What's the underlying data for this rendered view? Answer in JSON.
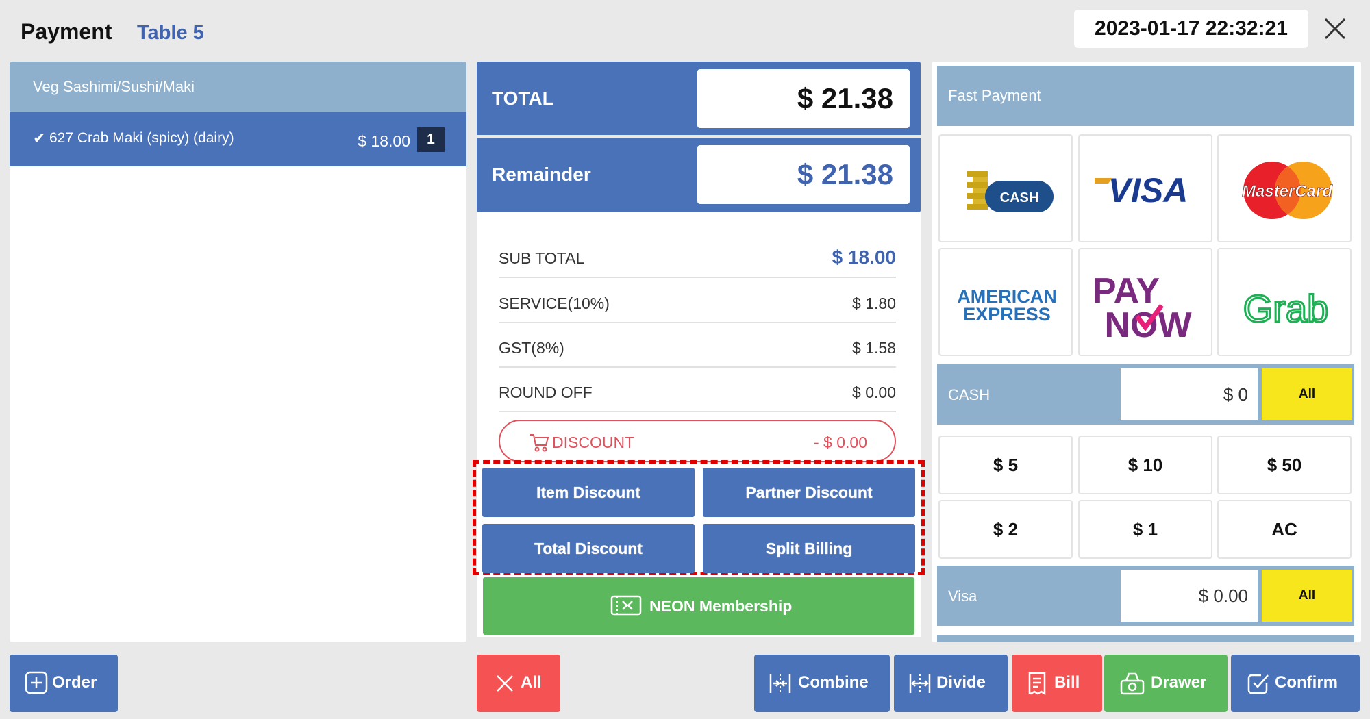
{
  "header": {
    "title": "Payment",
    "table": "Table 5",
    "datetime": "2023-01-17 22:32:21"
  },
  "order": {
    "category": "Veg Sashimi/Sushi/Maki",
    "items": [
      {
        "check": "✔",
        "name": "627 Crab Maki (spicy) (dairy)",
        "price": "$ 18.00",
        "qty": "1"
      }
    ]
  },
  "totals": {
    "total_label": "TOTAL",
    "total_value": "$ 21.38",
    "remainder_label": "Remainder",
    "remainder_value": "$ 21.38",
    "remainder_color": "#3f63ae"
  },
  "summary": {
    "rows": [
      {
        "label": "SUB TOTAL",
        "value": "$ 18.00"
      },
      {
        "label": "SERVICE(10%)",
        "value": "$ 1.80"
      },
      {
        "label": "GST(8%)",
        "value": "$ 1.58"
      },
      {
        "label": "ROUND OFF",
        "value": "$ 0.00"
      }
    ],
    "discount_label": "DISCOUNT",
    "discount_value": "- $ 0.00"
  },
  "discount_buttons": [
    "Item Discount",
    "Partner Discount",
    "Total Discount",
    "Split Billing"
  ],
  "membership_label": "NEON Membership",
  "fast_payment": {
    "title": "Fast Payment",
    "methods": [
      {
        "name": "Cash",
        "icon": "cash-icon",
        "text": "CASH"
      },
      {
        "name": "Visa",
        "icon": "visa-icon",
        "text": "VISA"
      },
      {
        "name": "MasterCard",
        "icon": "mastercard-icon",
        "text": "MasterCard"
      },
      {
        "name": "American Express",
        "icon": "amex-icon",
        "text_1": "AMERICAN",
        "text_2": "EXPRESS"
      },
      {
        "name": "PayNow",
        "icon": "paynow-icon",
        "text_1": "PAY",
        "text_2": "NOW"
      },
      {
        "name": "Grab",
        "icon": "grab-icon",
        "text": "Grab"
      }
    ]
  },
  "cash_row": {
    "label": "CASH",
    "value": "$ 0",
    "all_label": "All"
  },
  "cash_buttons": [
    "$ 5",
    "$ 10",
    "$ 50",
    "$ 2",
    "$ 1",
    "AC"
  ],
  "visa_row": {
    "label": "Visa",
    "value": "$ 0.00",
    "all_label": "All"
  },
  "bottom_bar": {
    "order": "Order",
    "clear_all": "All",
    "combine": "Combine",
    "divide": "Divide",
    "bill": "Bill",
    "drawer": "Drawer",
    "confirm": "Confirm"
  },
  "colors": {
    "primary_blue": "#4a72b8",
    "light_blue": "#8eb0cc",
    "danger_red": "#f55353",
    "success_green": "#5cb85c",
    "all_yellow": "#f7e61c",
    "discount_red": "#e0515c"
  }
}
